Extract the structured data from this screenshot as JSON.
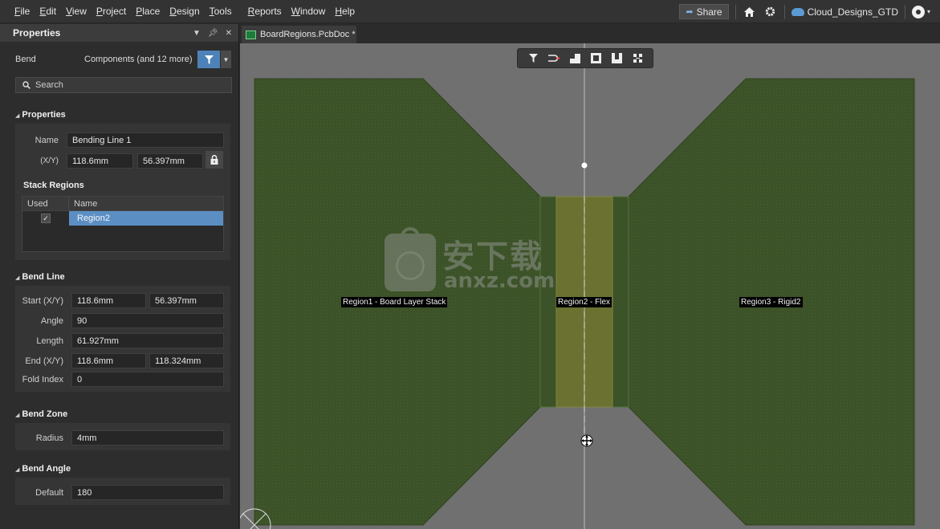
{
  "menu": [
    "File",
    "Edit",
    "View",
    "Project",
    "Place",
    "Design",
    "Tools",
    "Reports",
    "Window",
    "Help"
  ],
  "topbar": {
    "share_label": "Share",
    "workspace": "Cloud_Designs_GTD"
  },
  "panel": {
    "title": "Properties",
    "object_type": "Bend",
    "filter_text": "Components (and 12 more)",
    "search_placeholder": "Search",
    "properties": {
      "header": "Properties",
      "name_label": "Name",
      "name_value": "Bending Line 1",
      "xy_label": "(X/Y)",
      "x_value": "118.6mm",
      "y_value": "56.397mm"
    },
    "stack_regions": {
      "title": "Stack Regions",
      "col_used": "Used",
      "col_name": "Name",
      "rows": [
        {
          "used": true,
          "name": "Region2"
        }
      ]
    },
    "bend_line": {
      "header": "Bend Line",
      "start_label": "Start (X/Y)",
      "start_x": "118.6mm",
      "start_y": "56.397mm",
      "angle_label": "Angle",
      "angle_value": "90",
      "length_label": "Length",
      "length_value": "61.927mm",
      "end_label": "End (X/Y)",
      "end_x": "118.6mm",
      "end_y": "118.324mm",
      "fold_label": "Fold Index",
      "fold_value": "0"
    },
    "bend_zone": {
      "header": "Bend Zone",
      "radius_label": "Radius",
      "radius_value": "4mm"
    },
    "bend_angle": {
      "header": "Bend Angle",
      "default_label": "Default",
      "default_value": "180"
    }
  },
  "document_tab": "BoardRegions.PcbDoc *",
  "canvas": {
    "region1_label": "Region1 - Board Layer Stack",
    "region2_label": "Region2 - Flex",
    "region3_label": "Region3 - Rigid2",
    "watermark_cn": "安下载",
    "watermark_url": "anxz.com",
    "colors": {
      "background": "#707070",
      "rigid_board": "#3c5228",
      "flex_region": "#6b7131",
      "panel_accent": "#4d82b8"
    }
  }
}
